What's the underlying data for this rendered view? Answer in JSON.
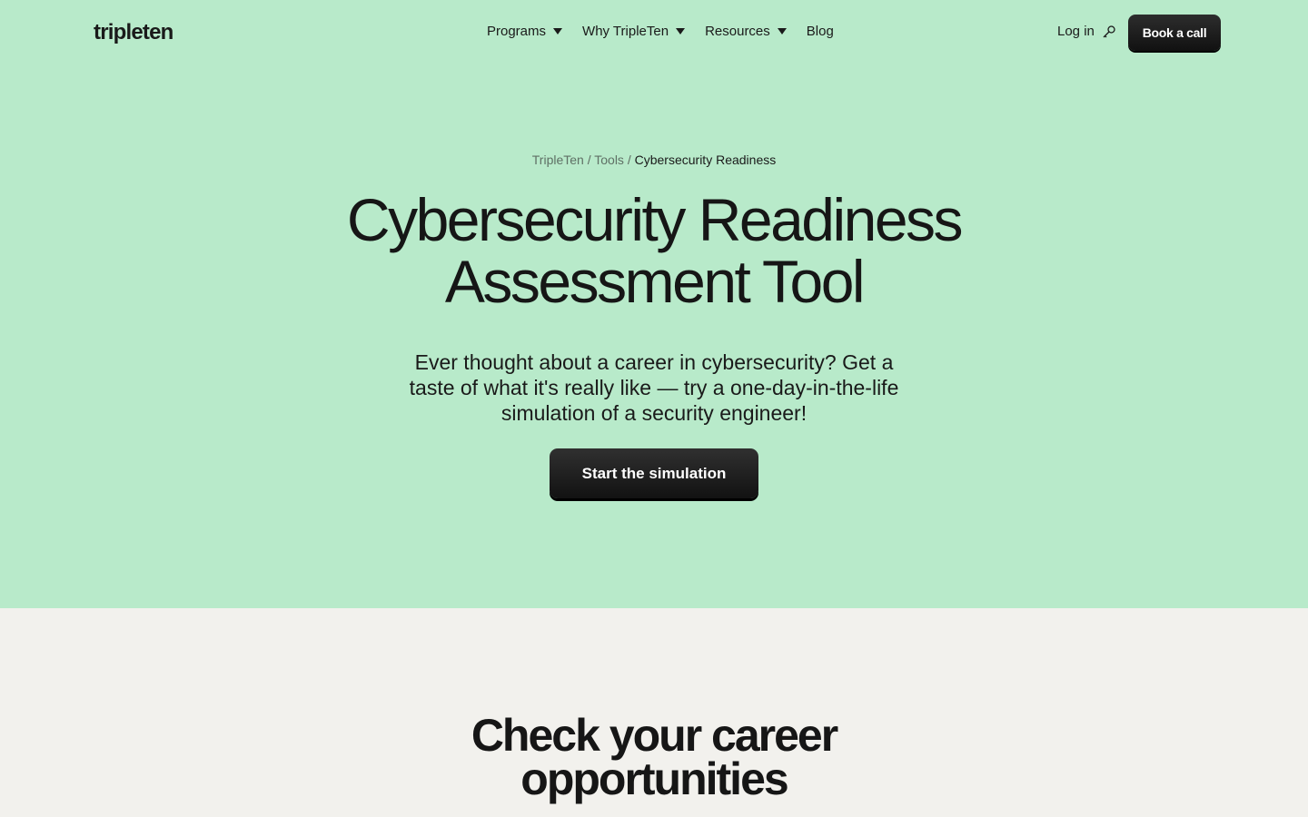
{
  "nav": {
    "logo": "tripleten",
    "links": [
      {
        "label": "Programs"
      },
      {
        "label": "Why TripleTen"
      },
      {
        "label": "Resources"
      },
      {
        "label": "Blog"
      }
    ],
    "login_label": "Log in",
    "login_icon": "key-icon",
    "book_call_label": "Book a call"
  },
  "breadcrumb": {
    "items": [
      "TripleTen",
      "Tools",
      "Cybersecurity Readiness"
    ],
    "separator": "/"
  },
  "hero": {
    "title_line1": "Cybersecurity Readiness",
    "title_line2": "Assessment Tool",
    "subtitle": "Ever thought about a career in cybersecurity? Get a taste of what it's really like — try a one-day-in-the-life simulation of a security engineer!",
    "cta_label": "Start the simulation"
  },
  "section": {
    "title_regular": "Check",
    "title_bold": "your career",
    "title_line2": "opportunities"
  },
  "colors": {
    "hero_bg": "#b8eaca",
    "page_bg": "#f2f1ed",
    "button_bg": "#1a1a1a",
    "text": "#1a1a1a"
  }
}
